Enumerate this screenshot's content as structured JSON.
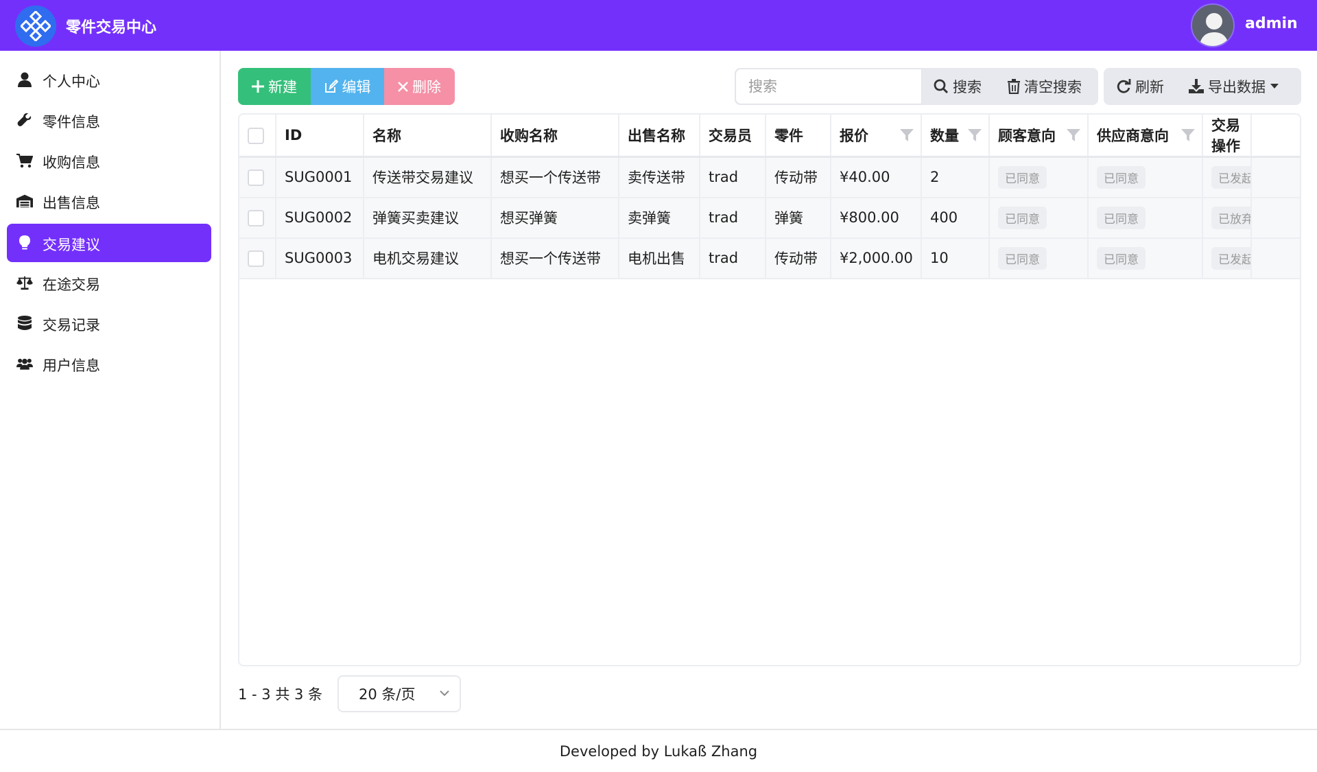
{
  "header": {
    "app_title": "零件交易中心",
    "user_name": "admin",
    "brand_color": "#7430fb"
  },
  "sidebar": {
    "items": [
      {
        "label": "个人中心",
        "icon": "user-icon",
        "active": false
      },
      {
        "label": "零件信息",
        "icon": "wrench-icon",
        "active": false
      },
      {
        "label": "收购信息",
        "icon": "cart-icon",
        "active": false
      },
      {
        "label": "出售信息",
        "icon": "warehouse-icon",
        "active": false
      },
      {
        "label": "交易建议",
        "icon": "lightbulb-icon",
        "active": true
      },
      {
        "label": "在途交易",
        "icon": "balance-scale-icon",
        "active": false
      },
      {
        "label": "交易记录",
        "icon": "database-icon",
        "active": false
      },
      {
        "label": "用户信息",
        "icon": "users-icon",
        "active": false
      }
    ]
  },
  "toolbar": {
    "new_label": "新建",
    "edit_label": "编辑",
    "delete_label": "删除",
    "search_placeholder": "搜索",
    "search_label": "搜索",
    "clear_search_label": "清空搜索",
    "refresh_label": "刷新",
    "export_label": "导出数据"
  },
  "table": {
    "columns": [
      "ID",
      "名称",
      "收购名称",
      "出售名称",
      "交易员",
      "零件",
      "报价",
      "数量",
      "顾客意向",
      "供应商意向",
      "交易操作"
    ],
    "rows": [
      {
        "id": "SUG0001",
        "name": "传送带交易建议",
        "buy_name": "想买一个传送带",
        "sell_name": "卖传送带",
        "trader": "trad",
        "part": "传动带",
        "price": "¥40.00",
        "qty": "2",
        "customer_intent": "已同意",
        "supplier_intent": "已同意",
        "action": "已发起协议"
      },
      {
        "id": "SUG0002",
        "name": "弹簧买卖建议",
        "buy_name": "想买弹簧",
        "sell_name": "卖弹簧",
        "trader": "trad",
        "part": "弹簧",
        "price": "¥800.00",
        "qty": "400",
        "customer_intent": "已同意",
        "supplier_intent": "已同意",
        "action": "已放弃建议"
      },
      {
        "id": "SUG0003",
        "name": "电机交易建议",
        "buy_name": "想买一个传送带",
        "sell_name": "电机出售",
        "trader": "trad",
        "part": "传动带",
        "price": "¥2,000.00",
        "qty": "10",
        "customer_intent": "已同意",
        "supplier_intent": "已同意",
        "action": "已发起协议"
      }
    ]
  },
  "pagination": {
    "info": "1 - 3 共 3 条",
    "page_size": "20 条/页"
  },
  "footer": {
    "text": "Developed by Lukaß Zhang"
  }
}
